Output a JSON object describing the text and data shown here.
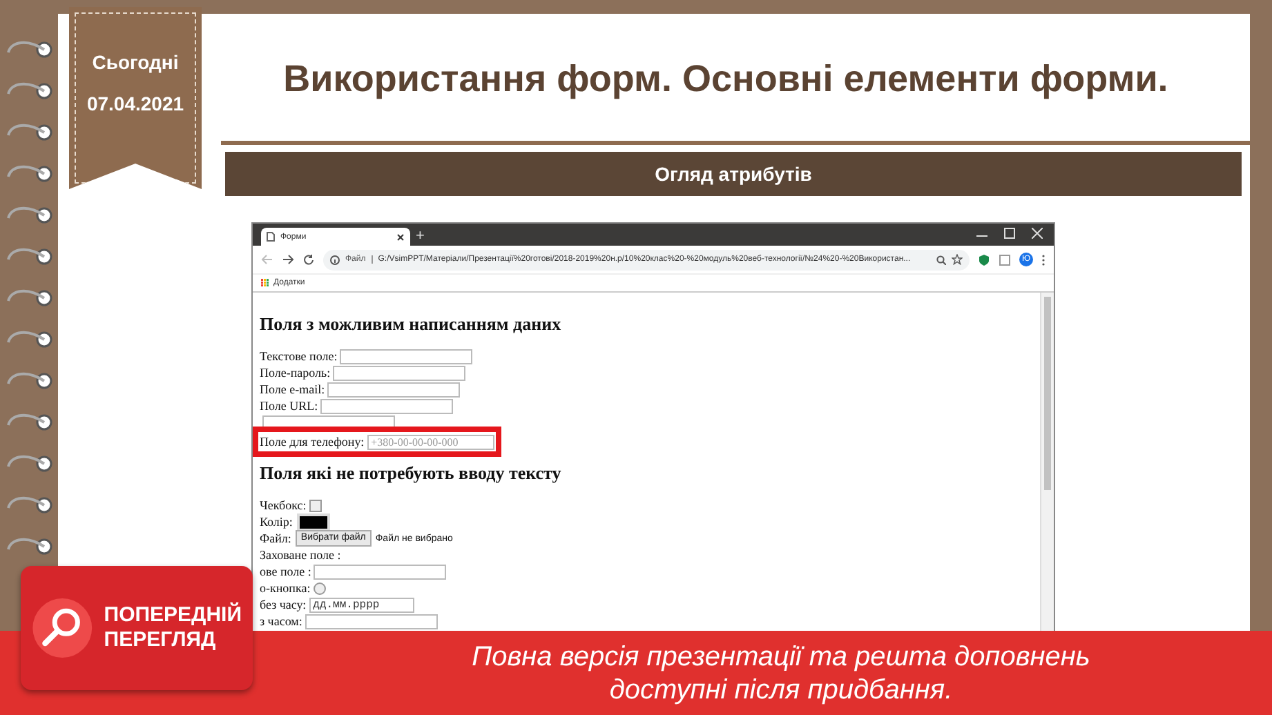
{
  "slide": {
    "date_label": "Сьогодні",
    "date": "07.04.2021",
    "title": "Використання форм. Основні елементи форми.",
    "subtitle": "Огляд атрибутів"
  },
  "browser": {
    "tab_title": "Форми",
    "new_tab": "+",
    "address_prefix": "Файл",
    "url": "G:/VsimPPT/Матеріали/Презентації%20готові/2018-2019%20н.р/10%20клас%20-%20модуль%20веб-технології/№24%20-%20Використан...",
    "profile_initial": "Ю",
    "bookmarks_label": "Додатки",
    "sections": [
      {
        "heading": "Поля з можливим написанням даних",
        "fields": [
          {
            "kind": "text",
            "label": "Текстове поле:",
            "highlighted": false
          },
          {
            "kind": "text",
            "label": "Поле-пароль:",
            "highlighted": false
          },
          {
            "kind": "text",
            "label": "Поле e-mail:",
            "highlighted": false
          },
          {
            "kind": "text",
            "label": "Поле URL:",
            "highlighted": false
          },
          {
            "kind": "text",
            "highlighted": false
          },
          {
            "kind": "text",
            "label": "Поле для телефону:",
            "placeholder": "+380-00-00-00-000",
            "highlighted": true
          }
        ]
      },
      {
        "heading": "Поля які не потребують вводу тексту",
        "fields": [
          {
            "kind": "checkbox",
            "label": "Чекбокс:",
            "checked": false
          },
          {
            "kind": "color",
            "label": "Колір:",
            "color": "#000000"
          },
          {
            "kind": "file",
            "label": "Файл:",
            "button": "Вибрати файл",
            "status": "Файл не вибрано"
          },
          {
            "kind": "hidden",
            "label": "Заховане поле :"
          },
          {
            "kind": "text",
            "label": "ове поле :",
            "highlighted": false
          },
          {
            "kind": "radio",
            "label": "о-кнопка:",
            "selected": false
          },
          {
            "kind": "date",
            "label": "без часу:",
            "value": "дд.мм.рррр"
          },
          {
            "kind": "text",
            "label": "з часом:",
            "highlighted": false
          }
        ]
      }
    ]
  },
  "preview_badge": {
    "line_1": "ПОПЕРЕДНІЙ",
    "line_2": "ПЕРЕГЛЯД"
  },
  "notice": {
    "lines": [
      "Повна версія презентації та решта доповнень",
      "доступні після придбання."
    ]
  }
}
